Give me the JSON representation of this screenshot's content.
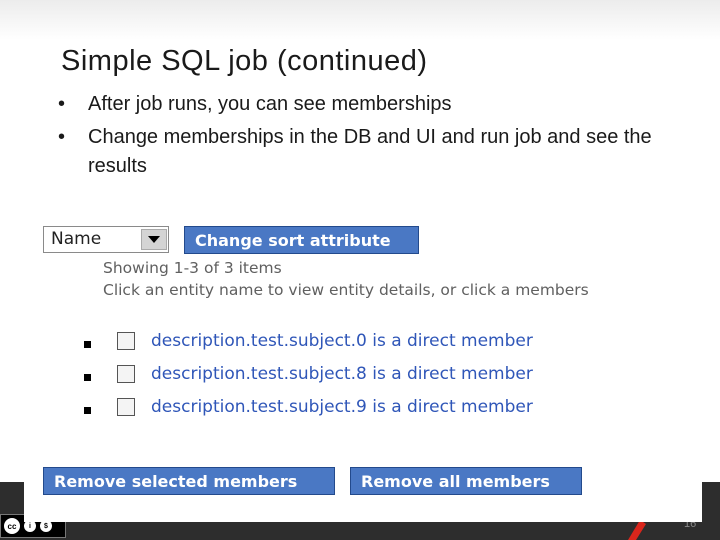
{
  "slide": {
    "title": "Simple SQL job (continued)",
    "bullets": [
      "After job runs, you can see memberships",
      "Change memberships in the DB and UI and run job and see the results"
    ],
    "page_number": "16",
    "license_badge": "cc BY NC"
  },
  "ui": {
    "sort_select": {
      "value": "Name"
    },
    "sort_button_label": "Change sort attribute",
    "showing_text": "Showing 1-3 of 3 items",
    "instruction_text": "Click an entity name to view entity details, or click a members",
    "members": [
      "description.test.subject.0 is a direct member",
      "description.test.subject.8 is a direct member",
      "description.test.subject.9 is a direct member"
    ],
    "remove_selected_label": "Remove selected members",
    "remove_all_label": "Remove all members"
  },
  "colors": {
    "button_blue": "#4a78c4",
    "link_blue": "#2f56b8",
    "accent_red": "#d9261c"
  }
}
